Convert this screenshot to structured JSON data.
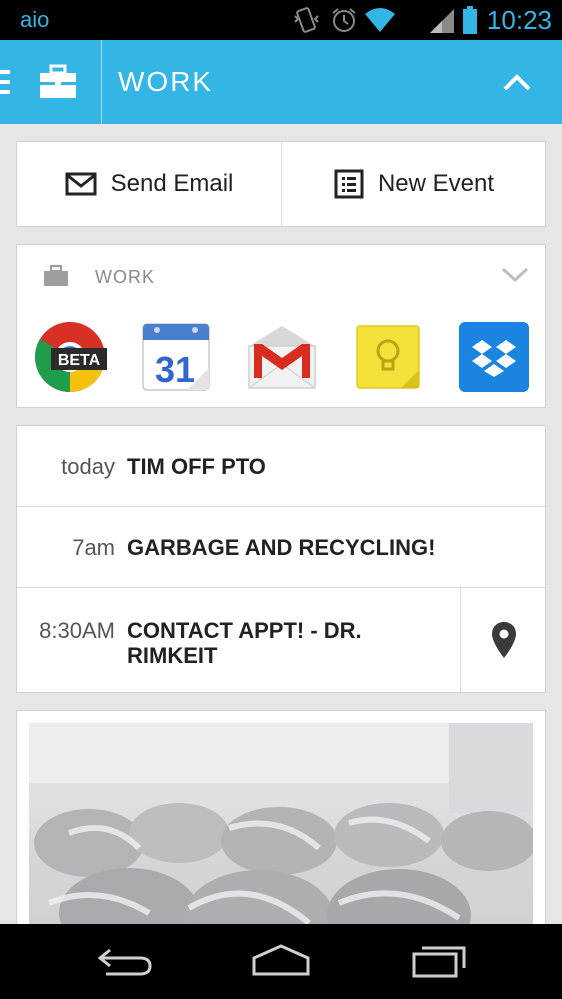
{
  "status_bar": {
    "app_label": "aio",
    "time": "10:23",
    "icons": [
      "vibrate-icon",
      "alarm-icon",
      "wifi-icon",
      "signal-icon",
      "battery-icon"
    ]
  },
  "action_bar": {
    "title": "WORK",
    "icons": [
      "menu-icon",
      "briefcase-icon",
      "chevron-up-icon"
    ]
  },
  "quick_actions": {
    "send_email": "Send Email",
    "new_event": "New Event"
  },
  "apps_card": {
    "header": "WORK",
    "apps": [
      {
        "name": "chrome-beta",
        "badge": "BETA"
      },
      {
        "name": "calendar",
        "day": "31"
      },
      {
        "name": "gmail",
        "letter": "M"
      },
      {
        "name": "keep"
      },
      {
        "name": "dropbox"
      }
    ]
  },
  "events": [
    {
      "time": "today",
      "title": "TIM OFF PTO"
    },
    {
      "time": "7am",
      "title": "GARBAGE AND RECYCLING!"
    },
    {
      "time": "8:30AM",
      "title_line1": "CONTACT APPT! - DR.",
      "title_line2": "RIMKEIT",
      "icon": "location-pin-icon"
    }
  ],
  "colors": {
    "accent": "#33b5e5",
    "background": "#e6e6e6",
    "card": "#ffffff",
    "text_dark": "#222222",
    "text_muted": "#8a8a8a"
  },
  "nav_bar": {
    "icons": [
      "back-icon",
      "home-icon",
      "recent-apps-icon"
    ]
  }
}
